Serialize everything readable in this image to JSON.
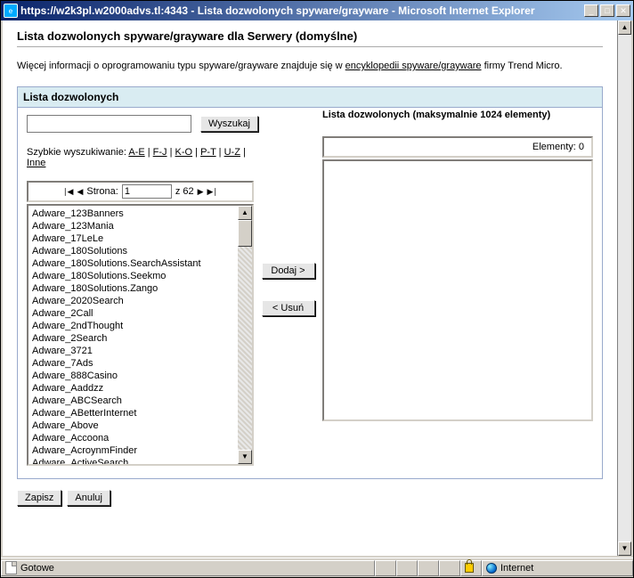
{
  "titlebar": {
    "url_title": "https://w2k3pl.w2000advs.tl:4343 - Lista dozwolonych spyware/grayware - Microsoft Internet Explorer"
  },
  "page": {
    "heading": "Lista dozwolonych spyware/grayware dla Serwery (domyślne)",
    "intro_prefix": "Więcej informacji o oprogramowaniu typu spyware/grayware znajduje się w ",
    "intro_link": "encyklopedii spyware/grayware",
    "intro_suffix": " firmy Trend Micro."
  },
  "panel": {
    "title": "Lista dozwolonych",
    "search_btn": "Wyszukaj",
    "quick_label": "Szybkie wyszukiwanie: ",
    "quick_links": [
      "A-E",
      "F-J",
      "K-O",
      "P-T",
      "U-Z",
      "Inne"
    ],
    "right_head": "Lista dozwolonych (maksymalnie 1024 elementy)"
  },
  "pager": {
    "label_page": "Strona:",
    "value": "1",
    "of": "z 62"
  },
  "elements": {
    "label": "Elementy: 0"
  },
  "buttons": {
    "add": "Dodaj >",
    "remove": "< Usuń",
    "save": "Zapisz",
    "cancel": "Anuluj"
  },
  "list": {
    "items": [
      "Adware_123Banners",
      "Adware_123Mania",
      "Adware_17LeLe",
      "Adware_180Solutions",
      "Adware_180Solutions.SearchAssistant",
      "Adware_180Solutions.Seekmo",
      "Adware_180Solutions.Zango",
      "Adware_2020Search",
      "Adware_2Call",
      "Adware_2ndThought",
      "Adware_2Search",
      "Adware_3721",
      "Adware_7Ads",
      "Adware_888Casino",
      "Adware_Aaddzz",
      "Adware_ABCSearch",
      "Adware_ABetterInternet",
      "Adware_Above",
      "Adware_Accoona",
      "Adware_AcroynmFinder",
      "Adware_ActiveSearch"
    ]
  },
  "status": {
    "ready": "Gotowe",
    "zone": "Internet"
  }
}
